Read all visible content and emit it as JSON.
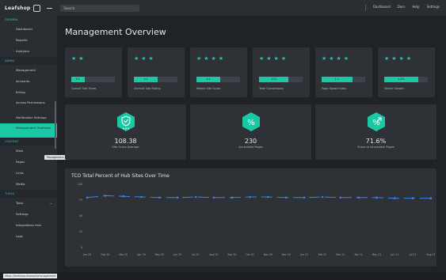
{
  "topbar": {
    "brand": "Leafshop",
    "search_placeholder": "Search",
    "right_items": [
      "Dashboard",
      "Docs",
      "Help",
      "Settings"
    ]
  },
  "sidebar": {
    "sections": [
      {
        "title": "General",
        "items": [
          {
            "label": "Dashboard"
          },
          {
            "label": "Reports"
          },
          {
            "label": "Analytics"
          }
        ]
      },
      {
        "title": "Admin",
        "items": [
          {
            "label": "Management"
          },
          {
            "label": "Accounts"
          },
          {
            "label": "Billing"
          },
          {
            "label": "Access Permissions"
          },
          {
            "label": "Notification Settings"
          },
          {
            "label": "Management Overview",
            "active": true
          }
        ]
      },
      {
        "title": "Content",
        "items": [
          {
            "label": "Sites"
          },
          {
            "label": "Pages"
          },
          {
            "label": "Links"
          },
          {
            "label": "Media"
          }
        ]
      },
      {
        "title": "Tools",
        "items": [
          {
            "label": "Tools"
          },
          {
            "label": "Settings"
          },
          {
            "label": "Integrations Hub"
          },
          {
            "label": "Logs"
          }
        ]
      }
    ],
    "tooltip": "Management Overview"
  },
  "main": {
    "title": "Management Overview",
    "rating_cards": [
      {
        "stars": 2,
        "bar_label": "5.1",
        "progress": 0.3,
        "label": "Overall Site Score"
      },
      {
        "stars": 3,
        "bar_label": "4.1",
        "progress": 0.55,
        "label": "Internal Site Rating"
      },
      {
        "stars": 4,
        "bar_label": "4.1",
        "progress": 0.55,
        "label": "Mobile Site Score"
      },
      {
        "stars": 4,
        "bar_label": "12%",
        "progress": 0.68,
        "label": "Total Conversions"
      },
      {
        "stars": 4,
        "bar_label": "1.2",
        "progress": 0.7,
        "label": "Page Speed Index"
      },
      {
        "stars": 4,
        "bar_label": "4.9%",
        "progress": 0.78,
        "label": "Visitor Growth"
      }
    ],
    "kpi_cards": [
      {
        "icon": "shield-star-icon",
        "value": "108.38",
        "label": "Site Score Average"
      },
      {
        "icon": "percent-icon",
        "value": "230",
        "label": "Accessible Pages"
      },
      {
        "icon": "percent-up-icon",
        "value": "71.6%",
        "label": "Share of Accessible Pages"
      }
    ],
    "chart_panel_title": "TCO Total Percent of Hub Sites Over Time"
  },
  "chart_data": {
    "type": "line",
    "title": "TCO Total Percent of Hub Sites Over Time",
    "xlabel": "",
    "ylabel": "",
    "x": [
      "Jan 20",
      "Feb 20",
      "Mar 20",
      "Apr 20",
      "May 20",
      "Jun 20",
      "Jul 20",
      "Aug 20",
      "Sep 20",
      "Oct 20",
      "Nov 20",
      "Dec 20",
      "Jan 21",
      "Feb 21",
      "Mar 21",
      "Apr 21",
      "May 21",
      "Jun 21",
      "Jul 21",
      "Aug 21"
    ],
    "series": [
      {
        "values": [
          79,
          82,
          81,
          80,
          79,
          79,
          80,
          79,
          79,
          80,
          80,
          79,
          79,
          80,
          79,
          79,
          79,
          78,
          78,
          78
        ]
      }
    ],
    "ylim": [
      0,
      100
    ],
    "grid": false,
    "accent_color": "#3b82f6"
  },
  "bottombar": {
    "url": "https://leafshop.example/management"
  },
  "colors": {
    "accent": "#19c9a6",
    "line": "#3b82f6"
  }
}
